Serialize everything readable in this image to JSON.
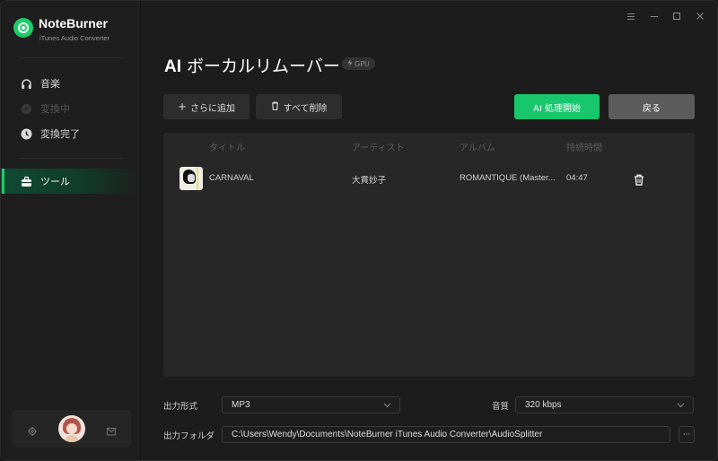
{
  "app": {
    "name": "NoteBurner",
    "subtitle": "iTunes Audio Converter"
  },
  "window_controls": [
    "menu-icon",
    "minimize-icon",
    "maximize-icon",
    "close-icon"
  ],
  "sidebar": {
    "items": [
      {
        "label": "音楽",
        "icon": "headphones-icon",
        "state": "normal"
      },
      {
        "label": "変換中",
        "icon": "converting-icon",
        "state": "disabled"
      },
      {
        "label": "変換完了",
        "icon": "clock-icon",
        "state": "normal"
      },
      {
        "label": "ツール",
        "icon": "toolbox-icon",
        "state": "active"
      }
    ],
    "footer": {
      "settings_icon": "gear-icon",
      "avatar": "user-avatar",
      "mail_icon": "mail-icon"
    }
  },
  "page": {
    "title_prefix": "AI",
    "title_rest": "ボーカルリムーバー",
    "badge": "GPU",
    "badge_icon": "lightning-icon"
  },
  "toolbar": {
    "add_label": "さらに追加",
    "delete_all_label": "すべて削除",
    "start_label": "AI 処理開始",
    "back_label": "戻る",
    "accent_color": "#18c66c"
  },
  "table": {
    "columns": [
      "タイトル",
      "アーティスト",
      "アルバム",
      "持続時間"
    ],
    "rows": [
      {
        "title": "CARNAVAL",
        "artist": "大貫妙子",
        "album": "ROMANTIQUE (Master...",
        "duration": "04:47"
      }
    ]
  },
  "settings": {
    "format_label": "出力形式",
    "format_value": "MP3",
    "quality_label": "音質",
    "quality_value": "320 kbps",
    "folder_label": "出力フォルダ",
    "folder_value": "C:\\Users\\Wendy\\Documents\\NoteBurner iTunes Audio Converter\\AudioSplitter",
    "browse_label": "···"
  }
}
